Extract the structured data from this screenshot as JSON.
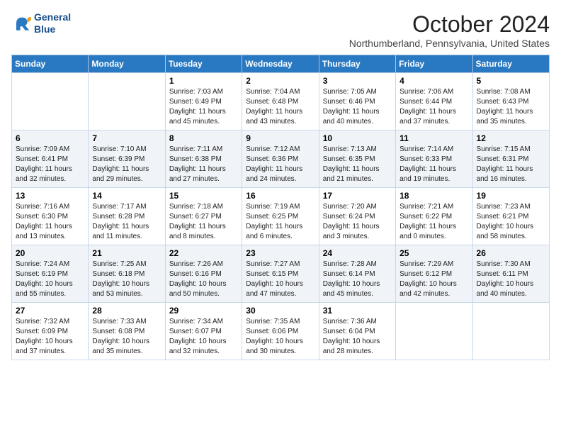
{
  "header": {
    "logo_line1": "General",
    "logo_line2": "Blue",
    "month": "October 2024",
    "location": "Northumberland, Pennsylvania, United States"
  },
  "days_of_week": [
    "Sunday",
    "Monday",
    "Tuesday",
    "Wednesday",
    "Thursday",
    "Friday",
    "Saturday"
  ],
  "weeks": [
    [
      {
        "day": "",
        "info": ""
      },
      {
        "day": "",
        "info": ""
      },
      {
        "day": "1",
        "info": "Sunrise: 7:03 AM\nSunset: 6:49 PM\nDaylight: 11 hours and 45 minutes."
      },
      {
        "day": "2",
        "info": "Sunrise: 7:04 AM\nSunset: 6:48 PM\nDaylight: 11 hours and 43 minutes."
      },
      {
        "day": "3",
        "info": "Sunrise: 7:05 AM\nSunset: 6:46 PM\nDaylight: 11 hours and 40 minutes."
      },
      {
        "day": "4",
        "info": "Sunrise: 7:06 AM\nSunset: 6:44 PM\nDaylight: 11 hours and 37 minutes."
      },
      {
        "day": "5",
        "info": "Sunrise: 7:08 AM\nSunset: 6:43 PM\nDaylight: 11 hours and 35 minutes."
      }
    ],
    [
      {
        "day": "6",
        "info": "Sunrise: 7:09 AM\nSunset: 6:41 PM\nDaylight: 11 hours and 32 minutes."
      },
      {
        "day": "7",
        "info": "Sunrise: 7:10 AM\nSunset: 6:39 PM\nDaylight: 11 hours and 29 minutes."
      },
      {
        "day": "8",
        "info": "Sunrise: 7:11 AM\nSunset: 6:38 PM\nDaylight: 11 hours and 27 minutes."
      },
      {
        "day": "9",
        "info": "Sunrise: 7:12 AM\nSunset: 6:36 PM\nDaylight: 11 hours and 24 minutes."
      },
      {
        "day": "10",
        "info": "Sunrise: 7:13 AM\nSunset: 6:35 PM\nDaylight: 11 hours and 21 minutes."
      },
      {
        "day": "11",
        "info": "Sunrise: 7:14 AM\nSunset: 6:33 PM\nDaylight: 11 hours and 19 minutes."
      },
      {
        "day": "12",
        "info": "Sunrise: 7:15 AM\nSunset: 6:31 PM\nDaylight: 11 hours and 16 minutes."
      }
    ],
    [
      {
        "day": "13",
        "info": "Sunrise: 7:16 AM\nSunset: 6:30 PM\nDaylight: 11 hours and 13 minutes."
      },
      {
        "day": "14",
        "info": "Sunrise: 7:17 AM\nSunset: 6:28 PM\nDaylight: 11 hours and 11 minutes."
      },
      {
        "day": "15",
        "info": "Sunrise: 7:18 AM\nSunset: 6:27 PM\nDaylight: 11 hours and 8 minutes."
      },
      {
        "day": "16",
        "info": "Sunrise: 7:19 AM\nSunset: 6:25 PM\nDaylight: 11 hours and 6 minutes."
      },
      {
        "day": "17",
        "info": "Sunrise: 7:20 AM\nSunset: 6:24 PM\nDaylight: 11 hours and 3 minutes."
      },
      {
        "day": "18",
        "info": "Sunrise: 7:21 AM\nSunset: 6:22 PM\nDaylight: 11 hours and 0 minutes."
      },
      {
        "day": "19",
        "info": "Sunrise: 7:23 AM\nSunset: 6:21 PM\nDaylight: 10 hours and 58 minutes."
      }
    ],
    [
      {
        "day": "20",
        "info": "Sunrise: 7:24 AM\nSunset: 6:19 PM\nDaylight: 10 hours and 55 minutes."
      },
      {
        "day": "21",
        "info": "Sunrise: 7:25 AM\nSunset: 6:18 PM\nDaylight: 10 hours and 53 minutes."
      },
      {
        "day": "22",
        "info": "Sunrise: 7:26 AM\nSunset: 6:16 PM\nDaylight: 10 hours and 50 minutes."
      },
      {
        "day": "23",
        "info": "Sunrise: 7:27 AM\nSunset: 6:15 PM\nDaylight: 10 hours and 47 minutes."
      },
      {
        "day": "24",
        "info": "Sunrise: 7:28 AM\nSunset: 6:14 PM\nDaylight: 10 hours and 45 minutes."
      },
      {
        "day": "25",
        "info": "Sunrise: 7:29 AM\nSunset: 6:12 PM\nDaylight: 10 hours and 42 minutes."
      },
      {
        "day": "26",
        "info": "Sunrise: 7:30 AM\nSunset: 6:11 PM\nDaylight: 10 hours and 40 minutes."
      }
    ],
    [
      {
        "day": "27",
        "info": "Sunrise: 7:32 AM\nSunset: 6:09 PM\nDaylight: 10 hours and 37 minutes."
      },
      {
        "day": "28",
        "info": "Sunrise: 7:33 AM\nSunset: 6:08 PM\nDaylight: 10 hours and 35 minutes."
      },
      {
        "day": "29",
        "info": "Sunrise: 7:34 AM\nSunset: 6:07 PM\nDaylight: 10 hours and 32 minutes."
      },
      {
        "day": "30",
        "info": "Sunrise: 7:35 AM\nSunset: 6:06 PM\nDaylight: 10 hours and 30 minutes."
      },
      {
        "day": "31",
        "info": "Sunrise: 7:36 AM\nSunset: 6:04 PM\nDaylight: 10 hours and 28 minutes."
      },
      {
        "day": "",
        "info": ""
      },
      {
        "day": "",
        "info": ""
      }
    ]
  ]
}
